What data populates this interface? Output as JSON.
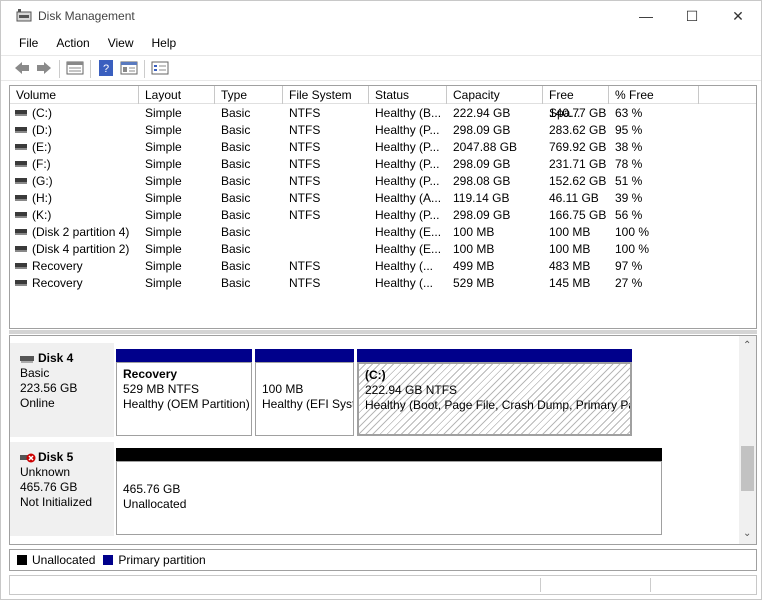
{
  "window": {
    "title": "Disk Management"
  },
  "controls": {
    "minimize": "—",
    "maximize": "☐",
    "close": "✕"
  },
  "menu": [
    "File",
    "Action",
    "View",
    "Help"
  ],
  "toolbar": {
    "icons": [
      "back-arrow-icon",
      "forward-arrow-icon",
      "show-list-icon",
      "help-icon",
      "properties-icon",
      "settings-icon"
    ]
  },
  "table": {
    "headers": [
      "Volume",
      "Layout",
      "Type",
      "File System",
      "Status",
      "Capacity",
      "Free Spa...",
      "% Free"
    ],
    "rows": [
      [
        "(C:)",
        "Simple",
        "Basic",
        "NTFS",
        "Healthy (B...",
        "222.94 GB",
        "140.77 GB",
        "63 %"
      ],
      [
        "(D:)",
        "Simple",
        "Basic",
        "NTFS",
        "Healthy (P...",
        "298.09 GB",
        "283.62 GB",
        "95 %"
      ],
      [
        "(E:)",
        "Simple",
        "Basic",
        "NTFS",
        "Healthy (P...",
        "2047.88 GB",
        "769.92 GB",
        "38 %"
      ],
      [
        "(F:)",
        "Simple",
        "Basic",
        "NTFS",
        "Healthy (P...",
        "298.09 GB",
        "231.71 GB",
        "78 %"
      ],
      [
        "(G:)",
        "Simple",
        "Basic",
        "NTFS",
        "Healthy (P...",
        "298.08 GB",
        "152.62 GB",
        "51 %"
      ],
      [
        "(H:)",
        "Simple",
        "Basic",
        "NTFS",
        "Healthy (A...",
        "119.14 GB",
        "46.11 GB",
        "39 %"
      ],
      [
        "(K:)",
        "Simple",
        "Basic",
        "NTFS",
        "Healthy (P...",
        "298.09 GB",
        "166.75 GB",
        "56 %"
      ],
      [
        "(Disk 2 partition 4)",
        "Simple",
        "Basic",
        "",
        "Healthy (E...",
        "100 MB",
        "100 MB",
        "100 %"
      ],
      [
        "(Disk 4 partition 2)",
        "Simple",
        "Basic",
        "",
        "Healthy (E...",
        "100 MB",
        "100 MB",
        "100 %"
      ],
      [
        "Recovery",
        "Simple",
        "Basic",
        "NTFS",
        "Healthy (...",
        "499 MB",
        "483 MB",
        "97 %"
      ],
      [
        "Recovery",
        "Simple",
        "Basic",
        "NTFS",
        "Healthy (...",
        "529 MB",
        "145 MB",
        "27 %"
      ]
    ]
  },
  "disk4": {
    "name": "Disk 4",
    "type": "Basic",
    "size": "223.56 GB",
    "state": "Online",
    "partitions": [
      {
        "name": "Recovery",
        "size": "529 MB NTFS",
        "status": "Healthy (OEM Partition)"
      },
      {
        "name": "",
        "size": "100 MB",
        "status": "Healthy (EFI System Partition)"
      },
      {
        "name": "(C:)",
        "size": "222.94 GB NTFS",
        "status": "Healthy (Boot, Page File, Crash Dump, Primary Partition)"
      }
    ]
  },
  "disk5": {
    "name": "Disk 5",
    "type": "Unknown",
    "size": "465.76 GB",
    "state": "Not Initialized",
    "partition": {
      "size": "465.76 GB",
      "status": "Unallocated"
    }
  },
  "legend": {
    "unallocated": "Unallocated",
    "primary": "Primary partition"
  },
  "colors": {
    "primary": "#00008b",
    "unallocated": "#000000"
  }
}
